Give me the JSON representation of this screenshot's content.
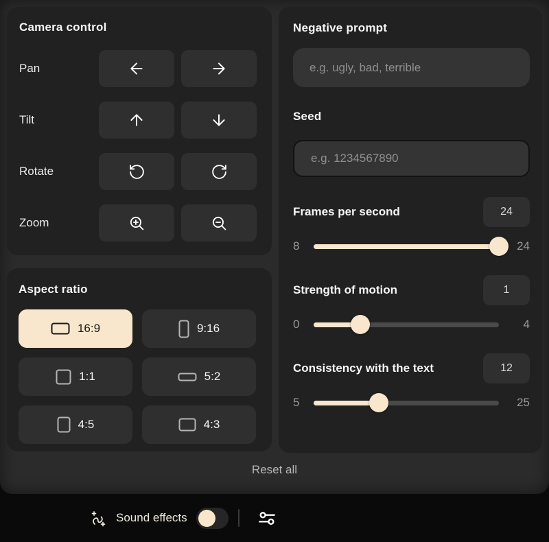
{
  "colors": {
    "page-bg": "#0a0a0a",
    "sheet-bg": "#2b2b2b",
    "panel-bg": "#212121",
    "control-bg": "#2f2f2f",
    "input-bg": "#343434",
    "track-bg": "#4a4a4a",
    "accent": "#f8e7cd"
  },
  "camera_control": {
    "title": "Camera control",
    "rows": [
      {
        "label": "Pan",
        "icons": [
          "arrow-left-icon",
          "arrow-right-icon"
        ]
      },
      {
        "label": "Tilt",
        "icons": [
          "arrow-up-icon",
          "arrow-down-icon"
        ]
      },
      {
        "label": "Rotate",
        "icons": [
          "rotate-ccw-icon",
          "rotate-cw-icon"
        ]
      },
      {
        "label": "Zoom",
        "icons": [
          "zoom-in-icon",
          "zoom-out-icon"
        ]
      }
    ]
  },
  "aspect_ratio": {
    "title": "Aspect ratio",
    "options": [
      {
        "label": "16:9",
        "icon": "landscape-rect-icon",
        "selected": true
      },
      {
        "label": "9:16",
        "icon": "portrait-rect-icon",
        "selected": false
      },
      {
        "label": "1:1",
        "icon": "square-rect-icon",
        "selected": false
      },
      {
        "label": "5:2",
        "icon": "wide-rect-icon",
        "selected": false
      },
      {
        "label": "4:5",
        "icon": "tall-rect-icon",
        "selected": false
      },
      {
        "label": "4:3",
        "icon": "classic-rect-icon",
        "selected": false
      }
    ]
  },
  "settings": {
    "negative_prompt": {
      "label": "Negative prompt",
      "placeholder": "e.g. ugly, bad, terrible",
      "value": ""
    },
    "seed": {
      "label": "Seed",
      "placeholder": "e.g. 1234567890",
      "value": ""
    },
    "sliders": [
      {
        "label": "Frames per second",
        "value": 24,
        "min": 8,
        "max": 24
      },
      {
        "label": "Strength of motion",
        "value": 1,
        "min": 0,
        "max": 4
      },
      {
        "label": "Consistency with the text",
        "value": 12,
        "min": 5,
        "max": 25
      }
    ]
  },
  "footer": {
    "reset_label": "Reset all"
  },
  "bottom_bar": {
    "sound_effects_label": "Sound effects",
    "sound_effects_on": false
  }
}
